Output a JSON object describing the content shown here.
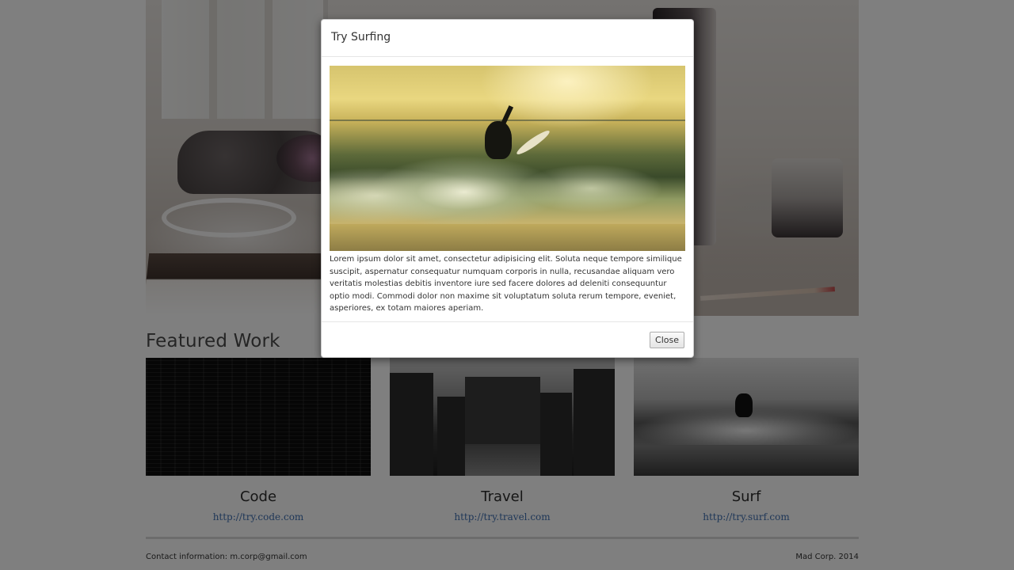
{
  "featured": {
    "heading": "Featured Work",
    "cards": [
      {
        "caption": "Code",
        "link": "http://try.code.com",
        "image": "code-thumbnail"
      },
      {
        "caption": "Travel",
        "link": "http://try.travel.com",
        "image": "travel-thumbnail"
      },
      {
        "caption": "Surf",
        "link": "http://try.surf.com",
        "image": "surf-thumbnail"
      }
    ]
  },
  "footer": {
    "contact": "Contact information: m.corp@gmail.com",
    "copyright": "Mad Corp. 2014"
  },
  "modal": {
    "title": "Try Surfing",
    "body": "Lorem ipsum dolor sit amet, consectetur adipisicing elit. Soluta neque tempore similique suscipit, aspernatur consequatur numquam corporis in nulla, recusandae aliquam vero veritatis molestias debitis inventore iure sed facere dolores ad deleniti consequuntur optio modi. Commodi dolor non maxime sit voluptatum soluta rerum tempore, eveniet, asperiores, ex totam maiores aperiam.",
    "close_label": "Close"
  },
  "colors": {
    "link": "#3f6fb0",
    "backdrop": "rgba(0,0,0,0.5)"
  }
}
